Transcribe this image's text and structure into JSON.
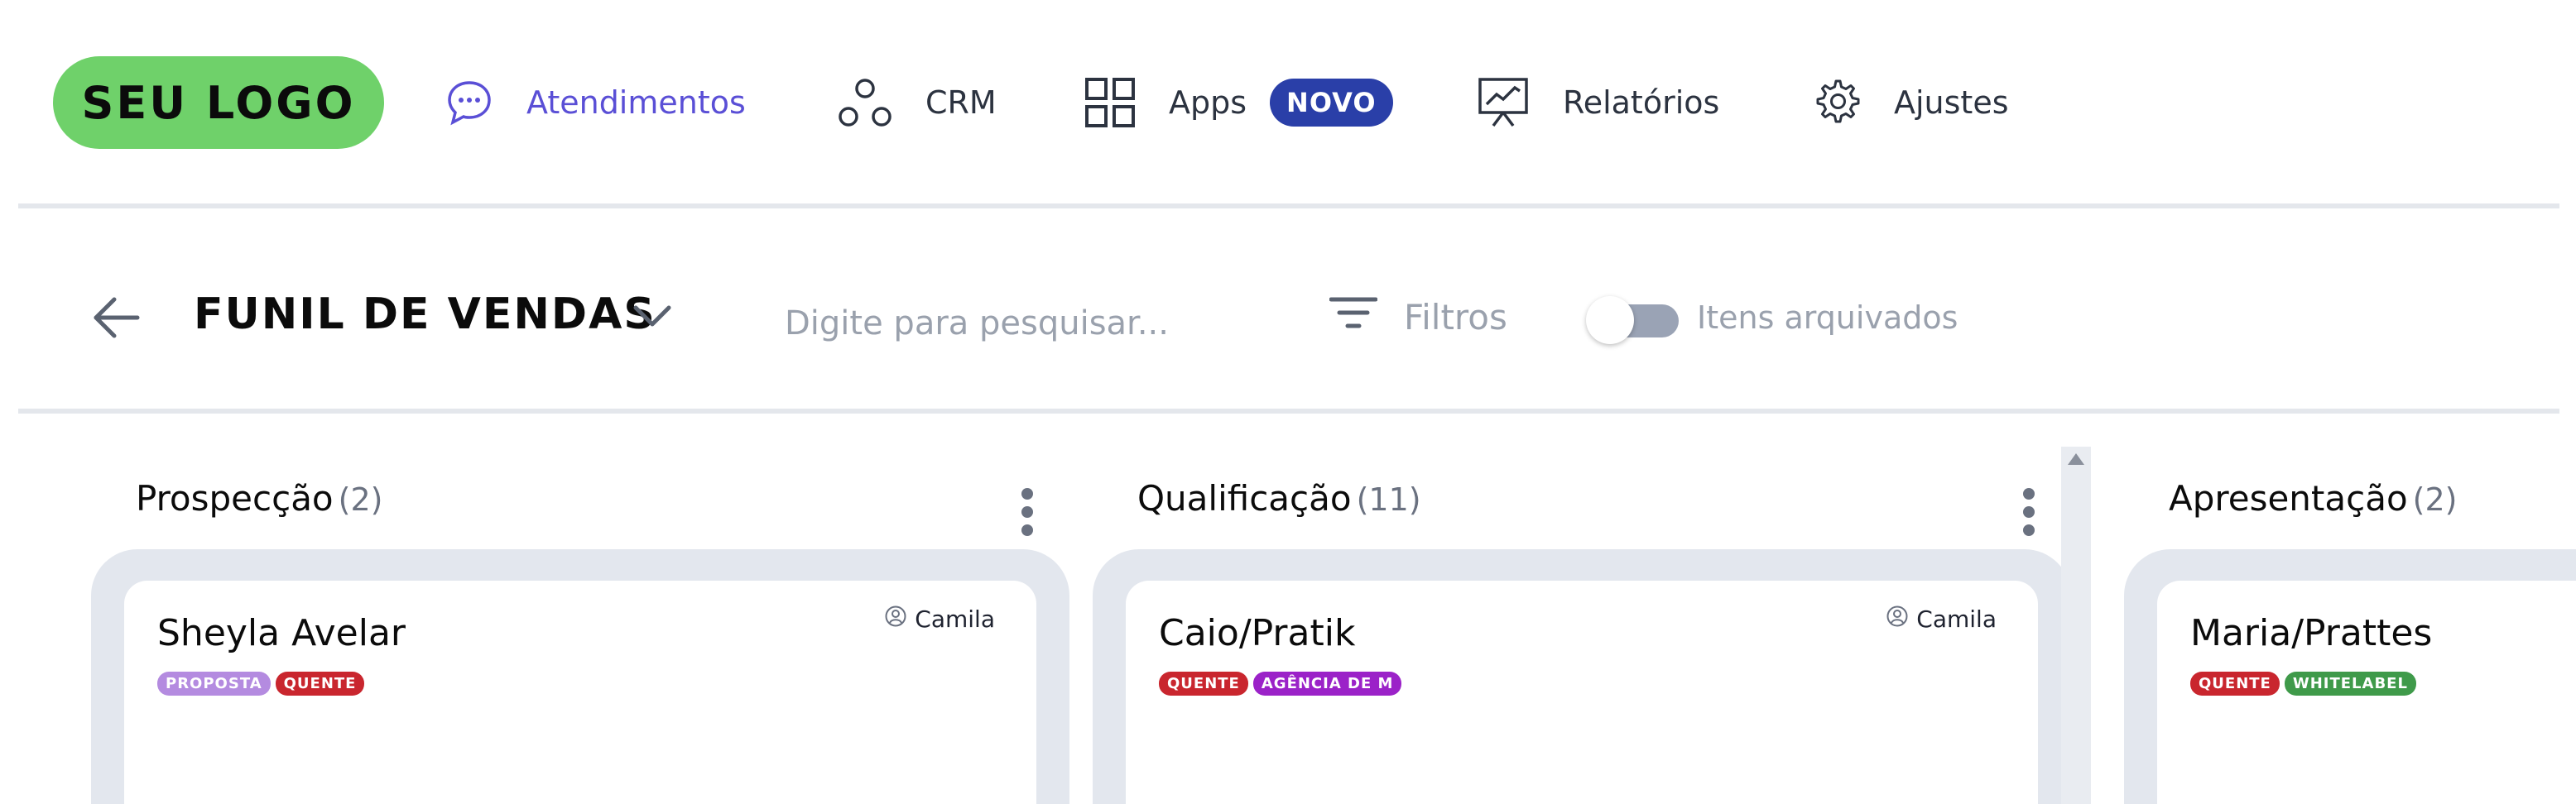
{
  "nav": {
    "logo": "SEU LOGO",
    "items": [
      {
        "label": "Atendimentos",
        "icon": "chat-icon"
      },
      {
        "label": "CRM",
        "icon": "crm-icon"
      },
      {
        "label": "Apps",
        "icon": "apps-grid-icon",
        "badge": "NOVO"
      },
      {
        "label": "Relatórios",
        "icon": "presentation-chart-icon"
      },
      {
        "label": "Ajustes",
        "icon": "gear-icon"
      }
    ],
    "active_color": "#5a4fd6",
    "badge_color": "#2a3fa8",
    "logo_color": "#6fd16a"
  },
  "toolbar": {
    "title": "FUNIL DE VENDAS",
    "search_placeholder": "Digite para pesquisar...",
    "filter_label": "Filtros",
    "archived_label": "Itens arquivados",
    "archived_on": false
  },
  "columns": [
    {
      "title": "Prospecção",
      "count": "(2)",
      "cards": [
        {
          "name": "Sheyla Avelar",
          "owner": "Camila",
          "tags": [
            {
              "label": "PROPOSTA",
              "color": "#b48be0"
            },
            {
              "label": "QUENTE",
              "color": "#c9262e"
            }
          ]
        }
      ]
    },
    {
      "title": "Qualificação",
      "count": "(11)",
      "cards": [
        {
          "name": "Caio/Pratik",
          "owner": "Camila",
          "tags": [
            {
              "label": "QUENTE",
              "color": "#c9262e"
            },
            {
              "label": "AGÊNCIA DE M",
              "color": "#9b22c8"
            }
          ]
        }
      ]
    },
    {
      "title": "Apresentação",
      "count": "(2)",
      "cards": [
        {
          "name": "Maria/Prattes",
          "owner": "",
          "tags": [
            {
              "label": "QUENTE",
              "color": "#c9262e"
            },
            {
              "label": "WHITELABEL",
              "color": "#3f9a4a"
            }
          ]
        }
      ]
    }
  ]
}
